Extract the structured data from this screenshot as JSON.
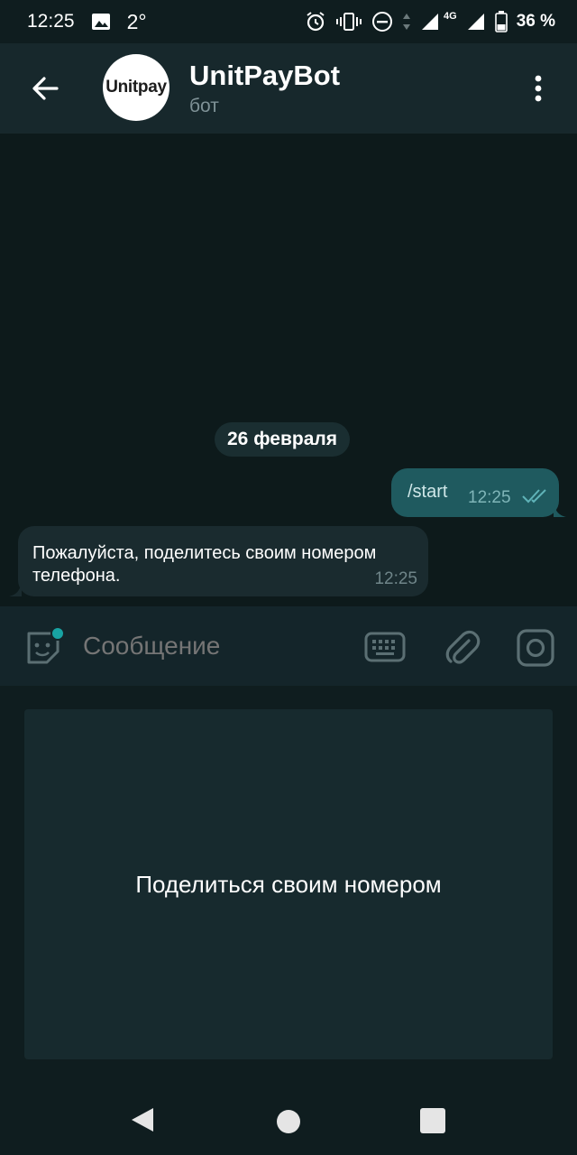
{
  "status_bar": {
    "time": "12:25",
    "temperature": "2°",
    "network": "4G",
    "battery": "36 %"
  },
  "header": {
    "title": "UnitPayBot",
    "subtitle": "бот",
    "avatar_text": "Unitpay"
  },
  "chat": {
    "date_separator": "26 февраля",
    "messages": [
      {
        "direction": "outgoing",
        "text": "/start",
        "time": "12:25",
        "status_icon": "double-check-icon"
      },
      {
        "direction": "incoming",
        "text": "Пожалуйста, поделитесь своим номером телефона.",
        "time": "12:25"
      }
    ]
  },
  "input": {
    "placeholder": "Сообщение"
  },
  "reply_keyboard": {
    "button_label": "Поделиться своим номером"
  },
  "colors": {
    "accent": "#1f5a5f",
    "badge": "#18a3a3",
    "header_bg": "#17282c"
  }
}
